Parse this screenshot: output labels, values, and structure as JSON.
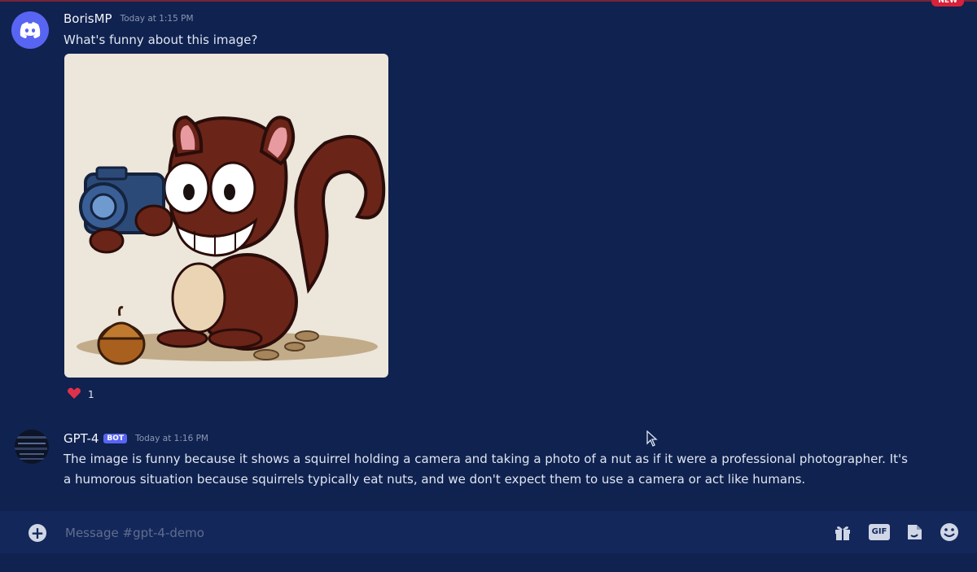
{
  "banner": {
    "new_label": "NEW"
  },
  "messages": [
    {
      "username": "BorisMP",
      "timestamp": "Today at 1:15 PM",
      "text": "What's funny about this image?",
      "avatar_icon": "discord-logo-icon",
      "attachment_icon": "squirrel-with-camera-image",
      "reaction": {
        "emoji": "heart-icon",
        "count": "1"
      }
    },
    {
      "username": "GPT-4",
      "badge": "BOT",
      "timestamp": "Today at 1:16 PM",
      "text_lines": [
        "The image is funny because it shows a squirrel holding a camera and taking a photo of a nut as if it were a professional photographer. It's",
        "a humorous situation because squirrels typically eat nuts, and we don't expect them to use a camera or act like humans."
      ],
      "avatar_icon": "gpt-avatar-icon"
    }
  ],
  "composer": {
    "placeholder": "Message #gpt-4-demo",
    "icons": [
      "plus-icon",
      "gift-icon",
      "gif-icon",
      "sticker-icon",
      "emoji-icon"
    ],
    "gif_label": "GIF"
  },
  "colors": {
    "background": "#10224f",
    "accent": "#5865f2",
    "heart": "#e0314b"
  }
}
